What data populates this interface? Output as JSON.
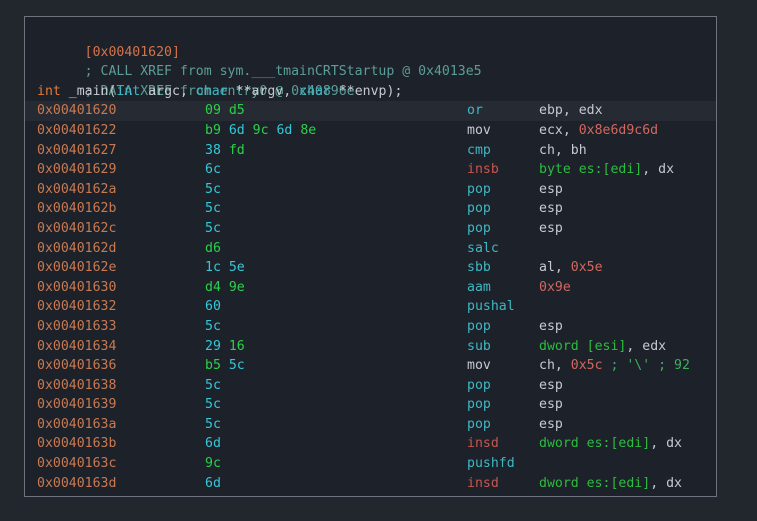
{
  "panel": {
    "name": "disassembly-panel",
    "colors": {
      "background": "#1d2129",
      "outer_background": "#22262d",
      "border": "#6d7480",
      "address": "#c97a52",
      "byte_cyan": "#35c8d8",
      "byte_green": "#2bd14a",
      "mnemonic_cyan": "#3fb8c4",
      "mnemonic_gray": "#c5c9d0",
      "mnemonic_red": "#c9564f",
      "immediate": "#d2685f",
      "memory": "#2bbd3f",
      "comment": "#3fae5c",
      "xref": "#5b9e99",
      "keyword": "#e07b39",
      "highlight_row": "#262b33"
    }
  },
  "header": {
    "address_label": "[0x00401620]",
    "xrefs": [
      "; CALL XREF from sym.___tmainCRTStartup @ 0x4013e5",
      "; DATA XREF from entry0 @ 0x40896e"
    ],
    "signature": {
      "return_type": "int",
      "name": "_main(",
      "params": "int argc, char **argv, char **envp",
      "terminator": ");"
    }
  },
  "instructions": [
    {
      "address": "0x00401620",
      "bytes": [
        {
          "v": "09",
          "c": "green"
        },
        {
          "v": "d5",
          "c": "green"
        }
      ],
      "mnemonic": "or",
      "mnemonic_color": "cyan",
      "operands": [
        {
          "t": "ebp",
          "c": "reg"
        },
        {
          "t": ", ",
          "c": "punct"
        },
        {
          "t": "edx",
          "c": "reg"
        }
      ],
      "selected": true
    },
    {
      "address": "0x00401622",
      "bytes": [
        {
          "v": "b9",
          "c": "green"
        },
        {
          "v": "6d",
          "c": "cyan"
        },
        {
          "v": "9c",
          "c": "green"
        },
        {
          "v": "6d",
          "c": "cyan"
        },
        {
          "v": "8e",
          "c": "green"
        }
      ],
      "mnemonic": "mov",
      "mnemonic_color": "gray",
      "operands": [
        {
          "t": "ecx",
          "c": "reg"
        },
        {
          "t": ", ",
          "c": "punct"
        },
        {
          "t": "0x8e6d9c6d",
          "c": "imm"
        }
      ],
      "selected": false
    },
    {
      "address": "0x00401627",
      "bytes": [
        {
          "v": "38",
          "c": "cyan"
        },
        {
          "v": "fd",
          "c": "green"
        }
      ],
      "mnemonic": "cmp",
      "mnemonic_color": "cyan",
      "operands": [
        {
          "t": "ch",
          "c": "reg"
        },
        {
          "t": ", ",
          "c": "punct"
        },
        {
          "t": "bh",
          "c": "reg"
        }
      ],
      "selected": false
    },
    {
      "address": "0x00401629",
      "bytes": [
        {
          "v": "6c",
          "c": "cyan"
        }
      ],
      "mnemonic": "insb",
      "mnemonic_color": "red",
      "operands": [
        {
          "t": "byte",
          "c": "size"
        },
        {
          "t": " ",
          "c": "punct"
        },
        {
          "t": "es:[edi]",
          "c": "mem"
        },
        {
          "t": ", ",
          "c": "punct"
        },
        {
          "t": "dx",
          "c": "reg"
        }
      ],
      "selected": false
    },
    {
      "address": "0x0040162a",
      "bytes": [
        {
          "v": "5c",
          "c": "cyan"
        }
      ],
      "mnemonic": "pop",
      "mnemonic_color": "cyan",
      "operands": [
        {
          "t": "esp",
          "c": "reg"
        }
      ],
      "selected": false
    },
    {
      "address": "0x0040162b",
      "bytes": [
        {
          "v": "5c",
          "c": "cyan"
        }
      ],
      "mnemonic": "pop",
      "mnemonic_color": "cyan",
      "operands": [
        {
          "t": "esp",
          "c": "reg"
        }
      ],
      "selected": false
    },
    {
      "address": "0x0040162c",
      "bytes": [
        {
          "v": "5c",
          "c": "cyan"
        }
      ],
      "mnemonic": "pop",
      "mnemonic_color": "cyan",
      "operands": [
        {
          "t": "esp",
          "c": "reg"
        }
      ],
      "selected": false
    },
    {
      "address": "0x0040162d",
      "bytes": [
        {
          "v": "d6",
          "c": "green"
        }
      ],
      "mnemonic": "salc",
      "mnemonic_color": "cyan",
      "operands": [],
      "selected": false
    },
    {
      "address": "0x0040162e",
      "bytes": [
        {
          "v": "1c",
          "c": "cyan"
        },
        {
          "v": "5e",
          "c": "cyan"
        }
      ],
      "mnemonic": "sbb",
      "mnemonic_color": "cyan",
      "operands": [
        {
          "t": "al",
          "c": "reg"
        },
        {
          "t": ", ",
          "c": "punct"
        },
        {
          "t": "0x5e",
          "c": "imm"
        }
      ],
      "selected": false
    },
    {
      "address": "0x00401630",
      "bytes": [
        {
          "v": "d4",
          "c": "green"
        },
        {
          "v": "9e",
          "c": "green"
        }
      ],
      "mnemonic": "aam",
      "mnemonic_color": "cyan",
      "operands": [
        {
          "t": "0x9e",
          "c": "imm"
        }
      ],
      "selected": false
    },
    {
      "address": "0x00401632",
      "bytes": [
        {
          "v": "60",
          "c": "cyan"
        }
      ],
      "mnemonic": "pushal",
      "mnemonic_color": "cyan",
      "operands": [],
      "selected": false
    },
    {
      "address": "0x00401633",
      "bytes": [
        {
          "v": "5c",
          "c": "cyan"
        }
      ],
      "mnemonic": "pop",
      "mnemonic_color": "cyan",
      "operands": [
        {
          "t": "esp",
          "c": "reg"
        }
      ],
      "selected": false
    },
    {
      "address": "0x00401634",
      "bytes": [
        {
          "v": "29",
          "c": "cyan"
        },
        {
          "v": "16",
          "c": "green"
        }
      ],
      "mnemonic": "sub",
      "mnemonic_color": "cyan",
      "operands": [
        {
          "t": "dword",
          "c": "size"
        },
        {
          "t": " ",
          "c": "punct"
        },
        {
          "t": "[esi]",
          "c": "mem"
        },
        {
          "t": ", ",
          "c": "punct"
        },
        {
          "t": "edx",
          "c": "reg"
        }
      ],
      "selected": false
    },
    {
      "address": "0x00401636",
      "bytes": [
        {
          "v": "b5",
          "c": "green"
        },
        {
          "v": "5c",
          "c": "cyan"
        }
      ],
      "mnemonic": "mov",
      "mnemonic_color": "gray",
      "operands": [
        {
          "t": "ch",
          "c": "reg"
        },
        {
          "t": ", ",
          "c": "punct"
        },
        {
          "t": "0x5c",
          "c": "imm"
        },
        {
          "t": " ; '\\' ; 92",
          "c": "cmt"
        }
      ],
      "selected": false
    },
    {
      "address": "0x00401638",
      "bytes": [
        {
          "v": "5c",
          "c": "cyan"
        }
      ],
      "mnemonic": "pop",
      "mnemonic_color": "cyan",
      "operands": [
        {
          "t": "esp",
          "c": "reg"
        }
      ],
      "selected": false
    },
    {
      "address": "0x00401639",
      "bytes": [
        {
          "v": "5c",
          "c": "cyan"
        }
      ],
      "mnemonic": "pop",
      "mnemonic_color": "cyan",
      "operands": [
        {
          "t": "esp",
          "c": "reg"
        }
      ],
      "selected": false
    },
    {
      "address": "0x0040163a",
      "bytes": [
        {
          "v": "5c",
          "c": "cyan"
        }
      ],
      "mnemonic": "pop",
      "mnemonic_color": "cyan",
      "operands": [
        {
          "t": "esp",
          "c": "reg"
        }
      ],
      "selected": false
    },
    {
      "address": "0x0040163b",
      "bytes": [
        {
          "v": "6d",
          "c": "cyan"
        }
      ],
      "mnemonic": "insd",
      "mnemonic_color": "red",
      "operands": [
        {
          "t": "dword",
          "c": "size"
        },
        {
          "t": " ",
          "c": "punct"
        },
        {
          "t": "es:[edi]",
          "c": "mem"
        },
        {
          "t": ", ",
          "c": "punct"
        },
        {
          "t": "dx",
          "c": "reg"
        }
      ],
      "selected": false
    },
    {
      "address": "0x0040163c",
      "bytes": [
        {
          "v": "9c",
          "c": "green"
        }
      ],
      "mnemonic": "pushfd",
      "mnemonic_color": "cyan",
      "operands": [],
      "selected": false
    },
    {
      "address": "0x0040163d",
      "bytes": [
        {
          "v": "6d",
          "c": "cyan"
        }
      ],
      "mnemonic": "insd",
      "mnemonic_color": "red",
      "operands": [
        {
          "t": "dword",
          "c": "size"
        },
        {
          "t": " ",
          "c": "punct"
        },
        {
          "t": "es:[edi]",
          "c": "mem"
        },
        {
          "t": ", ",
          "c": "punct"
        },
        {
          "t": "dx",
          "c": "reg"
        }
      ],
      "selected": false
    }
  ]
}
